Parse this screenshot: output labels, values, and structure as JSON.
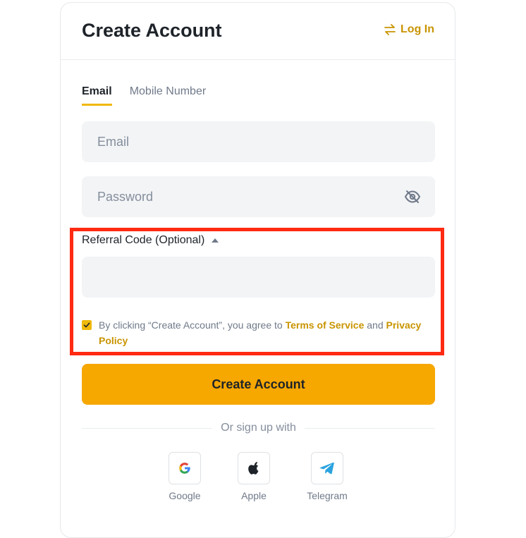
{
  "header": {
    "title": "Create Account",
    "login_label": "Log In"
  },
  "tabs": [
    {
      "label": "Email",
      "active": true
    },
    {
      "label": "Mobile Number",
      "active": false
    }
  ],
  "form": {
    "email_placeholder": "Email",
    "email_value": "",
    "password_placeholder": "Password",
    "password_value": "",
    "referral_label": "Referral Code (Optional)",
    "referral_value": "",
    "agree_prefix": "By clicking “Create Account”, you agree to",
    "terms_label": "Terms of Service",
    "and_text": "and",
    "privacy_label": "Privacy Policy",
    "agree_checked": true,
    "submit_label": "Create Account"
  },
  "social": {
    "divider_text": "Or sign up with",
    "providers": [
      {
        "label": "Google",
        "icon": "google-icon"
      },
      {
        "label": "Apple",
        "icon": "apple-icon"
      },
      {
        "label": "Telegram",
        "icon": "telegram-icon"
      }
    ]
  },
  "colors": {
    "brand_gold": "#f0b90b",
    "link_gold": "#c99400",
    "button_orange": "#f6a700",
    "highlight_red": "#ff2a12"
  }
}
